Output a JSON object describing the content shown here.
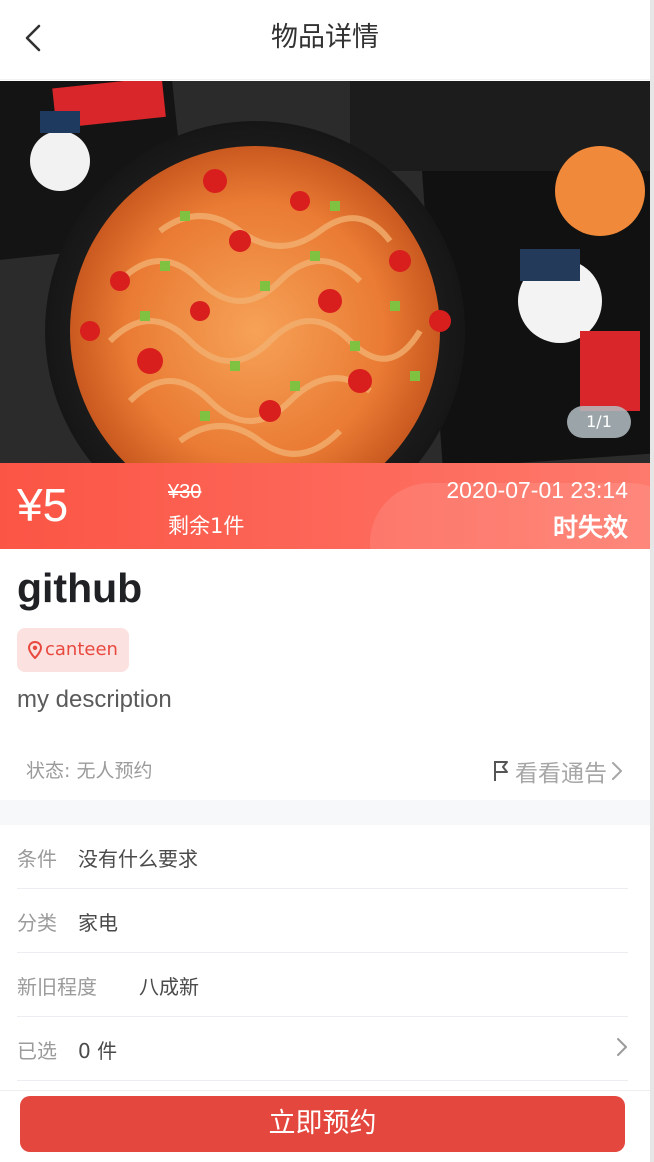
{
  "header": {
    "title": "物品详情"
  },
  "carousel": {
    "indicator": "1/1"
  },
  "price": {
    "current": "¥5",
    "original": "¥30",
    "remaining": "剩余1件",
    "expire_time": "2020-07-01 23:14",
    "expire_label": "时失效"
  },
  "item": {
    "title": "github",
    "location_tag": "canteen",
    "description": "my description",
    "status": "状态: 无人预约",
    "notice_link": "看看通告"
  },
  "attributes": [
    {
      "label": "条件",
      "value": "没有什么要求"
    },
    {
      "label": "分类",
      "value": "家电"
    },
    {
      "label": "新旧程度",
      "value": "八成新"
    },
    {
      "label": "已选",
      "value": "0 件"
    }
  ],
  "actions": {
    "reserve_button": "立即预约"
  },
  "colors": {
    "accent": "#fb5545",
    "button": "#e4473e",
    "tag_bg": "#fbe1e0"
  }
}
